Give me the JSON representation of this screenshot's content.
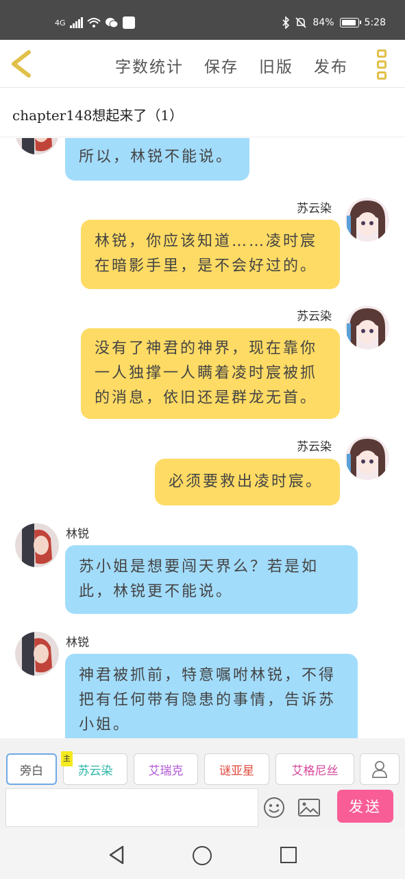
{
  "status_bar": {
    "network": "4G",
    "battery": "84%",
    "battery_level": 0.84,
    "time": "5:28"
  },
  "toolbar": {
    "word_count": "字数统计",
    "save": "保存",
    "old_version": "旧版",
    "publish": "发布"
  },
  "chapter_title": "chapter148想起来了（1）",
  "messages": [
    {
      "side": "left",
      "speaker": "",
      "text": "所以，林锐不能说。"
    },
    {
      "side": "right",
      "speaker": "苏云染",
      "text": "林锐，你应该知道……凌时宸在暗影手里，是不会好过的。",
      "lines": [
        "林锐，你应该知道……凌时宸",
        "在暗影手里，是不会好过的。"
      ]
    },
    {
      "side": "right",
      "speaker": "苏云染",
      "text": "没有了神君的神界，现在靠你一人独撑一人瞒着凌时宸被抓的消息，依旧还是群龙无首。",
      "lines": [
        "没有了神君的神界，现在靠你",
        "一人独撑一人瞒着凌时宸被抓",
        "的消息，依旧还是群龙无首。"
      ]
    },
    {
      "side": "right",
      "speaker": "苏云染",
      "text": "必须要救出凌时宸。"
    },
    {
      "side": "left",
      "speaker": "林锐",
      "text": "苏小姐是想要闯天界么？若是如此，林锐更不能说。",
      "lines": [
        "苏小姐是想要闯天界么？若是如",
        "此，林锐更不能说。"
      ]
    },
    {
      "side": "left",
      "speaker": "林锐",
      "text": "神君被抓前，特意嘱咐林锐，不得把有任何带有隐患的事情，告诉苏小姐。",
      "lines": [
        "神君被抓前，特意嘱咐林锐，不得",
        "把有任何带有隐患的事情，告诉苏",
        "小姐。"
      ]
    }
  ],
  "roles": {
    "narration": "旁白",
    "main_badge": "主",
    "role1": "苏云染",
    "role1_color": "#2bb6a8",
    "role2": "艾瑞克",
    "role2_color": "#b157d6",
    "role3": "谜亚星",
    "role3_color": "#e0493d",
    "role4": "艾格尼丝",
    "role4_color": "#d6459a"
  },
  "composer": {
    "input_value": "",
    "send": "发送"
  },
  "colors": {
    "blue_bubble": "#a2dcfb",
    "yellow_bubble": "#fedb64",
    "send_button": "#f85d96",
    "accent": "#e1c04a"
  }
}
